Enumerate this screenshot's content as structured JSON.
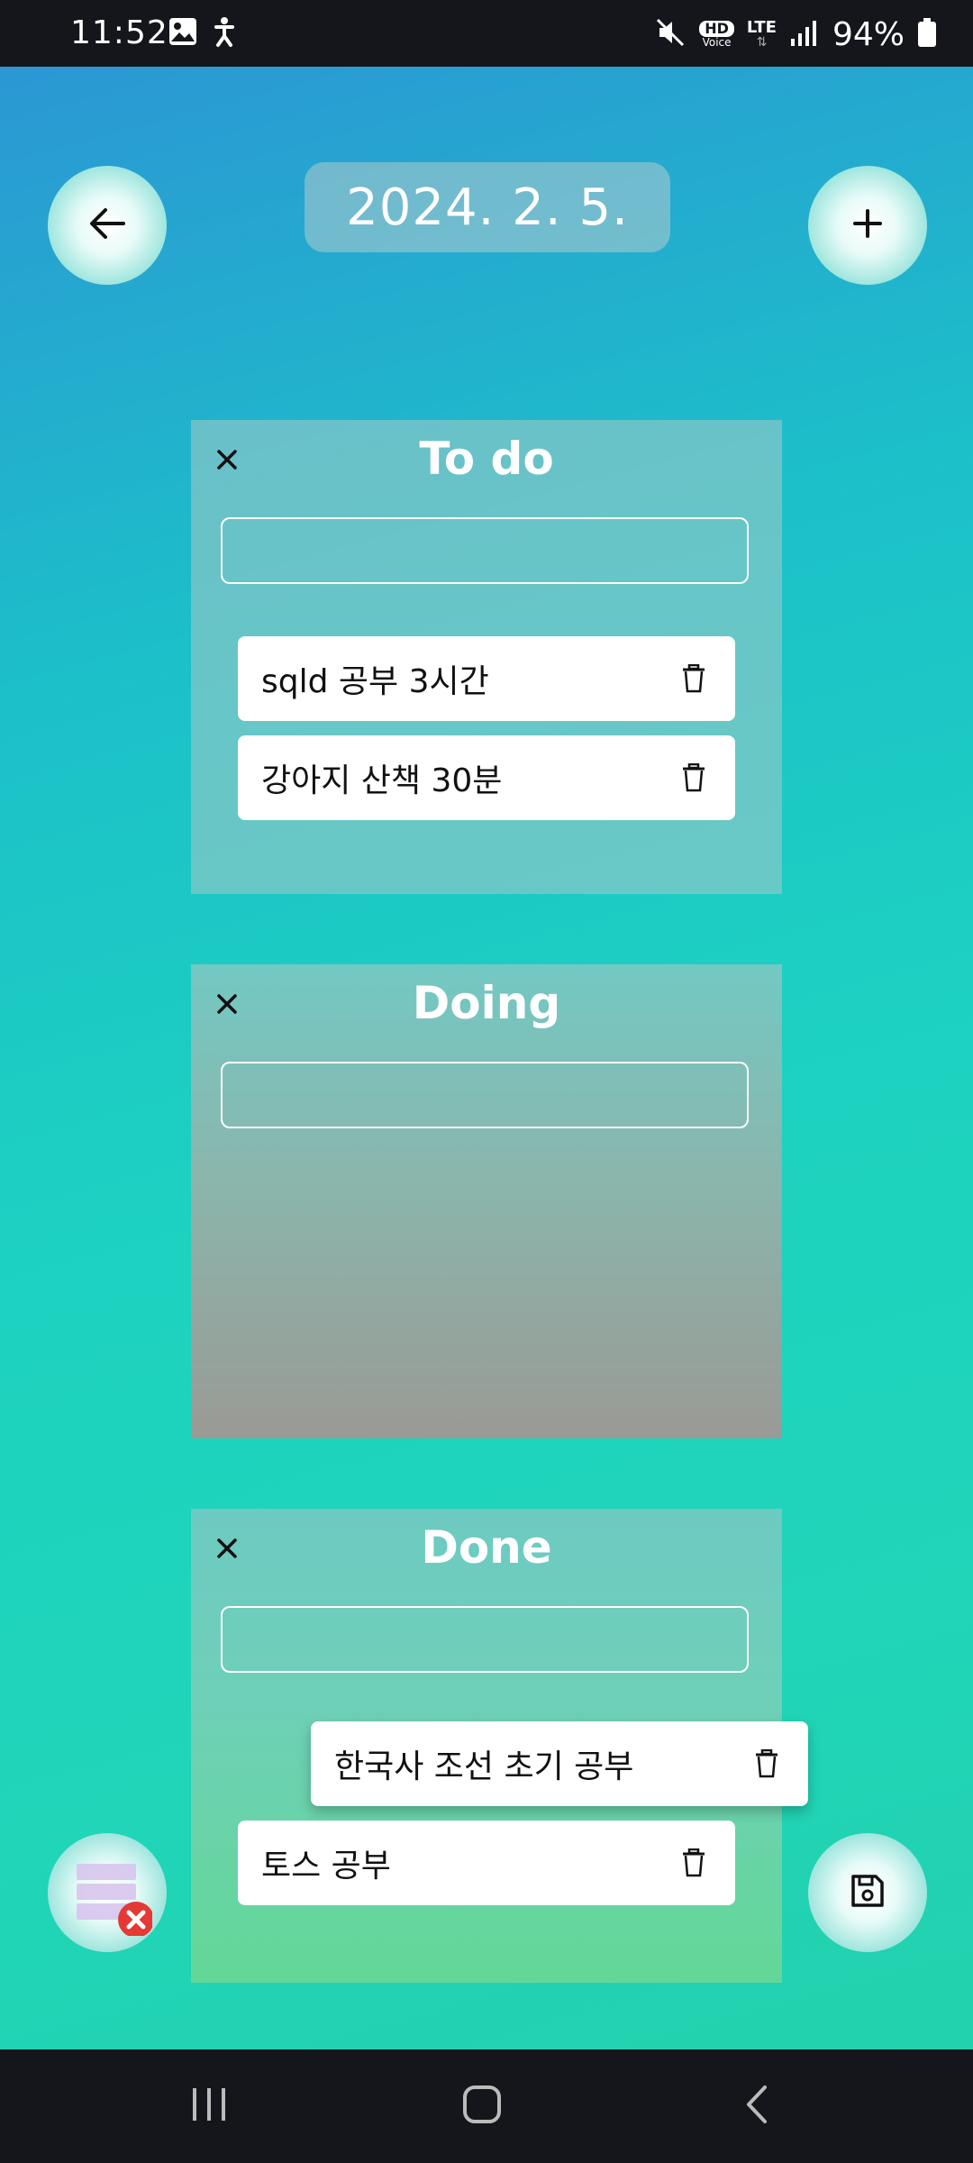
{
  "status_bar": {
    "time": "11:52",
    "battery_percent": "94%",
    "icons": [
      "gallery-icon",
      "accessibility-icon",
      "mute-icon",
      "hd-voice-icon",
      "lte-icon",
      "signal-icon",
      "battery-icon"
    ],
    "hd_label": "HD",
    "voice_label": "Voice",
    "lte_label": "LTE"
  },
  "header": {
    "date": "2024. 2. 5.",
    "back_icon": "arrow-left-icon",
    "add_icon": "plus-icon"
  },
  "panels": {
    "todo": {
      "title": "To do",
      "input_value": "",
      "tasks": [
        {
          "text": "sqld 공부 3시간"
        },
        {
          "text": "강아지 산책 30분"
        }
      ]
    },
    "doing": {
      "title": "Doing",
      "input_value": "",
      "tasks": []
    },
    "done": {
      "title": "Done",
      "input_value": "",
      "tasks": [
        {
          "text": "한국사 조선 초기 공부"
        },
        {
          "text": "토스 공부"
        }
      ]
    }
  },
  "bottom_buttons": {
    "left_icon": "clear-board-icon",
    "right_icon": "save-icon"
  },
  "colors": {
    "gradient_top": "#2b97d4",
    "gradient_bottom": "#22d1ad",
    "delete_badge": "#e53935"
  }
}
